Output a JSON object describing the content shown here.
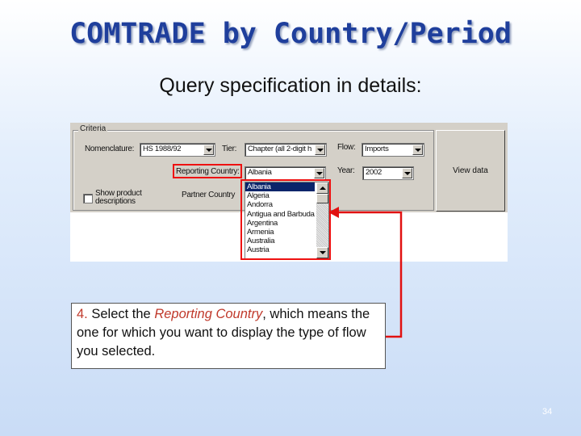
{
  "slide": {
    "title": "COMTRADE by Country/Period",
    "subtitle": "Query specification in details:",
    "page_number": "34"
  },
  "form": {
    "group_label": "Criteria",
    "nomenclature_label": "Nomenclature:",
    "nomenclature_value": "HS 1988/92",
    "tier_label": "Tier:",
    "tier_value": "Chapter (all 2-digit h",
    "flow_label": "Flow:",
    "flow_value": "Imports",
    "reporting_country_label": "Reporting Country:",
    "reporting_country_value": "Albania",
    "year_label": "Year:",
    "year_value": "2002",
    "show_product_label_line1": "Show product",
    "show_product_label_line2": "descriptions",
    "partner_country_label": "Partner Country",
    "view_button_label": "View data",
    "country_list": [
      "Albania",
      "Algeria",
      "Andorra",
      "Antigua and Barbuda",
      "Argentina",
      "Armenia",
      "Australia",
      "Austria"
    ],
    "selected_country": "Albania"
  },
  "callout": {
    "step_number": "4.",
    "text_before": " Select the ",
    "highlight": "Reporting Country",
    "text_after": ", which means the one for which you want to display the type of flow you selected."
  },
  "colors": {
    "title": "#1f3f9c",
    "highlight_red": "#e11111",
    "selection_blue": "#0a246a",
    "dialog_gray": "#d4d0c8"
  }
}
